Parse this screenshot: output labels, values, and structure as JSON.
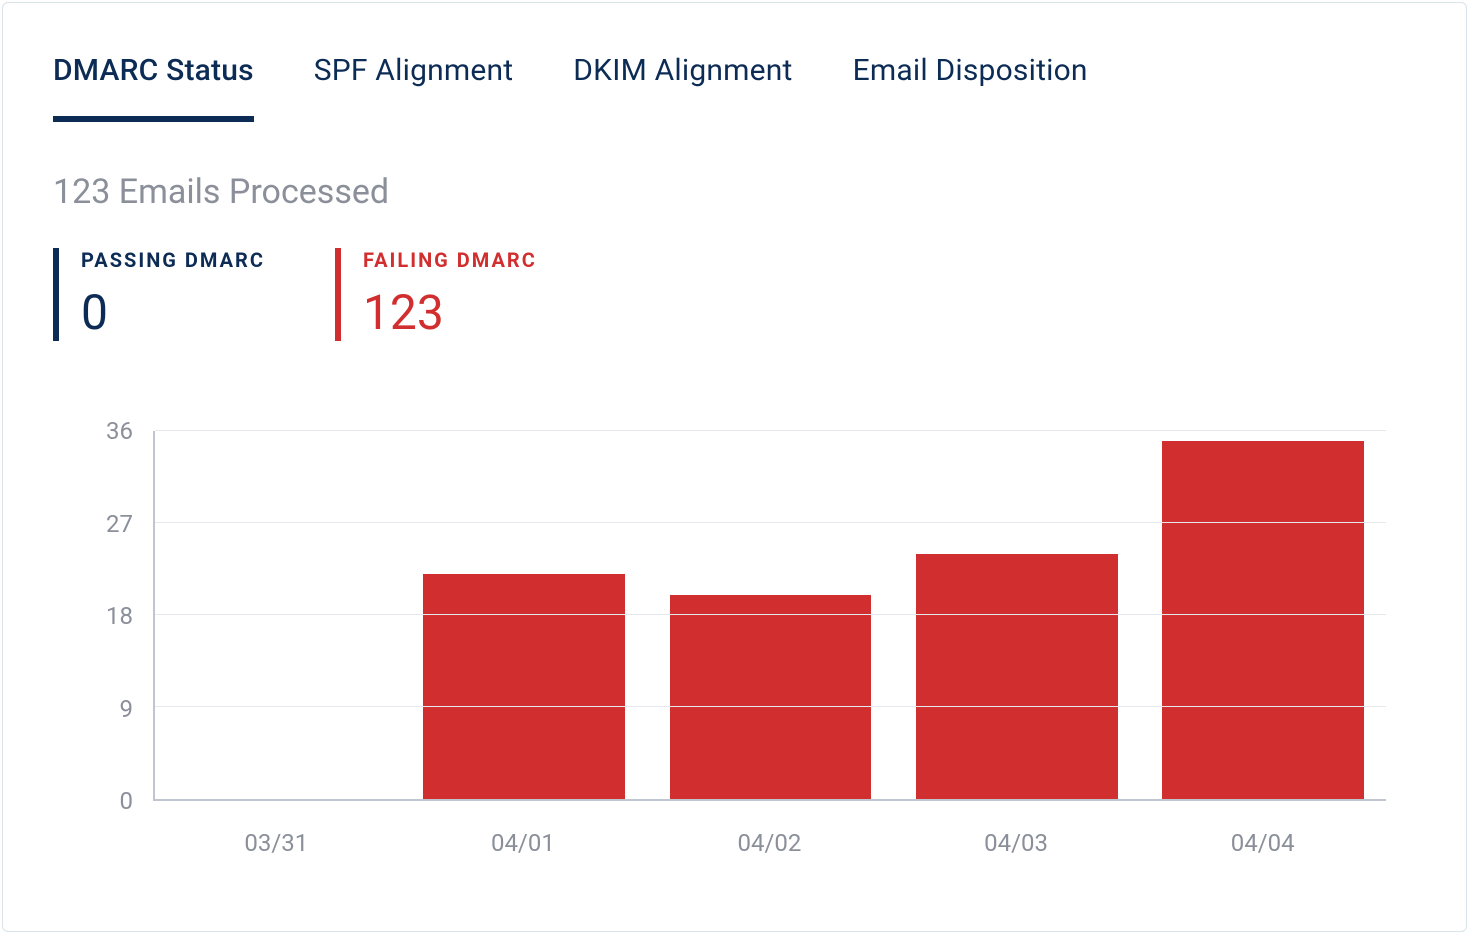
{
  "tabs": [
    {
      "label": "DMARC Status",
      "active": true
    },
    {
      "label": "SPF Alignment",
      "active": false
    },
    {
      "label": "DKIM Alignment",
      "active": false
    },
    {
      "label": "Email Disposition",
      "active": false
    }
  ],
  "summary_title": "123 Emails Processed",
  "stats": {
    "passing": {
      "label": "PASSING DMARC",
      "value": "0"
    },
    "failing": {
      "label": "FAILING DMARC",
      "value": "123"
    }
  },
  "colors": {
    "passing": "#0d2c55",
    "failing": "#d12f2f",
    "axis": "#bfc6cf",
    "grid": "#e5e8ec",
    "muted": "#8a8f99"
  },
  "chart_data": {
    "type": "bar",
    "categories": [
      "03/31",
      "04/01",
      "04/02",
      "04/03",
      "04/04"
    ],
    "values": [
      0,
      22,
      20,
      24,
      35
    ],
    "title": "",
    "xlabel": "",
    "ylabel": "",
    "ylim": [
      0,
      36
    ],
    "yticks": [
      0,
      9,
      18,
      27,
      36
    ],
    "grid": true,
    "series_name": "Failing DMARC",
    "bar_color": "#d12f2f"
  }
}
